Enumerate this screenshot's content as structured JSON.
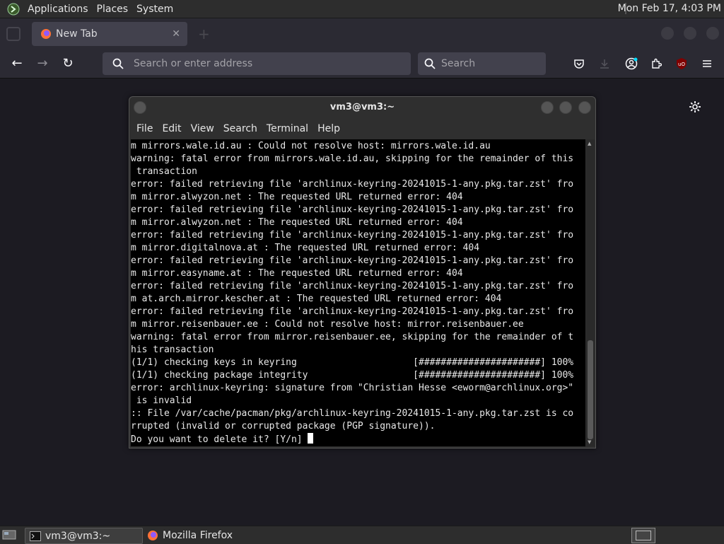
{
  "top_panel": {
    "menus": [
      "Applications",
      "Places",
      "System"
    ],
    "clock": "Mon Feb 17,  4:03 PM"
  },
  "browser": {
    "tab_title": "New Tab",
    "tab_close": "✕",
    "url_placeholder": "Search or enter address",
    "search_placeholder": "Search"
  },
  "terminal": {
    "title": "vm3@vm3:~",
    "menu": [
      "File",
      "Edit",
      "View",
      "Search",
      "Terminal",
      "Help"
    ],
    "lines": [
      "m mirrors.wale.id.au : Could not resolve host: mirrors.wale.id.au",
      "warning: fatal error from mirrors.wale.id.au, skipping for the remainder of this",
      " transaction",
      "error: failed retrieving file 'archlinux-keyring-20241015-1-any.pkg.tar.zst' fro",
      "m mirror.alwyzon.net : The requested URL returned error: 404",
      "error: failed retrieving file 'archlinux-keyring-20241015-1-any.pkg.tar.zst' fro",
      "m mirror.alwyzon.net : The requested URL returned error: 404",
      "error: failed retrieving file 'archlinux-keyring-20241015-1-any.pkg.tar.zst' fro",
      "m mirror.digitalnova.at : The requested URL returned error: 404",
      "error: failed retrieving file 'archlinux-keyring-20241015-1-any.pkg.tar.zst' fro",
      "m mirror.easyname.at : The requested URL returned error: 404",
      "error: failed retrieving file 'archlinux-keyring-20241015-1-any.pkg.tar.zst' fro",
      "m at.arch.mirror.kescher.at : The requested URL returned error: 404",
      "error: failed retrieving file 'archlinux-keyring-20241015-1-any.pkg.tar.zst' fro",
      "m mirror.reisenbauer.ee : Could not resolve host: mirror.reisenbauer.ee",
      "warning: fatal error from mirror.reisenbauer.ee, skipping for the remainder of t",
      "his transaction",
      "(1/1) checking keys in keyring                     [######################] 100%",
      "(1/1) checking package integrity                   [######################] 100%",
      "error: archlinux-keyring: signature from \"Christian Hesse <eworm@archlinux.org>\"",
      " is invalid",
      ":: File /var/cache/pacman/pkg/archlinux-keyring-20241015-1-any.pkg.tar.zst is co",
      "rrupted (invalid or corrupted package (PGP signature))."
    ],
    "prompt": "Do you want to delete it? [Y/n] "
  },
  "taskbar": {
    "tasks": [
      "vm3@vm3:~",
      "Mozilla Firefox"
    ]
  },
  "colors": {
    "terminal_bg": "#000000",
    "browser_chrome": "#2b2a33",
    "panel": "#2d2d2d"
  },
  "icons": {
    "top_panel_logo": "terminal-logo-icon",
    "nav": [
      "back-arrow-icon",
      "forward-arrow-icon",
      "reload-icon"
    ],
    "toolbar": [
      "pocket-icon",
      "download-icon",
      "account-icon",
      "extensions-icon",
      "ublock-icon",
      "menu-hamburger-icon"
    ],
    "page": "settings-gear-icon"
  }
}
